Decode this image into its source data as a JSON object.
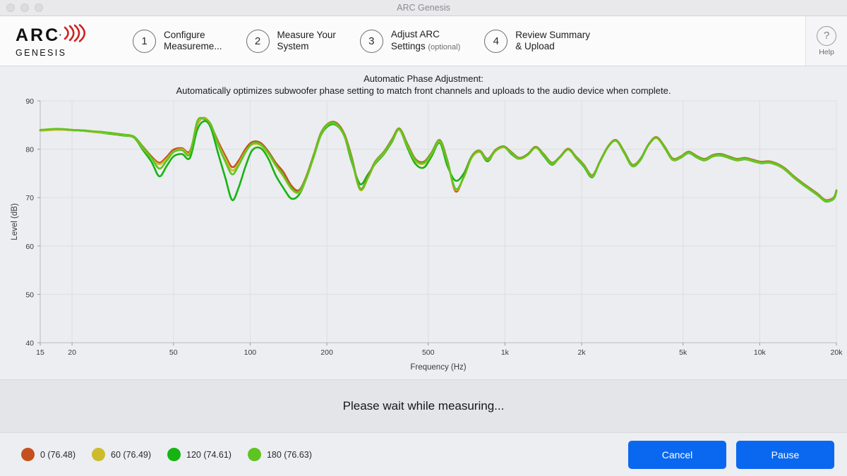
{
  "window": {
    "title": "ARC Genesis",
    "traffic_lights": [
      "close",
      "minimize",
      "zoom"
    ]
  },
  "header": {
    "logo": {
      "brand": "ARC",
      "sub": "GENESIS",
      "wave_color": "#cc2222"
    },
    "steps": [
      {
        "number": "1",
        "line1": "Configure",
        "line2": "Measureme...",
        "optional": ""
      },
      {
        "number": "2",
        "line1": "Measure Your",
        "line2": "System",
        "optional": ""
      },
      {
        "number": "3",
        "line1": "Adjust ARC",
        "line2": "Settings",
        "optional": "(optional)"
      },
      {
        "number": "4",
        "line1": "Review Summary",
        "line2": "& Upload",
        "optional": ""
      }
    ],
    "help": {
      "glyph": "?",
      "label": "Help"
    }
  },
  "main": {
    "caption_line1": "Automatic Phase Adjustment:",
    "caption_line2": "Automatically optimizes subwoofer phase setting to match front channels and uploads to the audio device when complete."
  },
  "status": {
    "text": "Please wait while measuring..."
  },
  "footer": {
    "legend": [
      {
        "label": "0 (76.48)",
        "color": "#c4501f"
      },
      {
        "label": "60 (76.49)",
        "color": "#ccbc2c"
      },
      {
        "label": "120 (74.61)",
        "color": "#15b411"
      },
      {
        "label": "180 (76.63)",
        "color": "#5ec420"
      }
    ],
    "buttons": [
      {
        "label": "Cancel",
        "color": "#0a68f0"
      },
      {
        "label": "Pause",
        "color": "#0a68f0"
      }
    ]
  },
  "chart_data": {
    "type": "line",
    "title": "",
    "xlabel": "Frequency (Hz)",
    "ylabel": "Level (dB)",
    "xscale": "log",
    "xlim": [
      15,
      20000
    ],
    "ylim": [
      40,
      90
    ],
    "grid": true,
    "legend_position": "bottom-left-outside",
    "xticks": [
      15,
      20,
      50,
      100,
      200,
      500,
      1000,
      2000,
      5000,
      10000,
      20000
    ],
    "xticklabels": [
      "15",
      "20",
      "50",
      "100",
      "200",
      "500",
      "1k",
      "2k",
      "5k",
      "10k",
      "20k"
    ],
    "yticks": [
      40,
      50,
      60,
      70,
      80,
      90
    ],
    "yticklabels": [
      "40",
      "50",
      "60",
      "70",
      "80",
      "90"
    ],
    "x": [
      15,
      16,
      17,
      18,
      19,
      20,
      22,
      24,
      26,
      28,
      30,
      32,
      35,
      38,
      41,
      44,
      47,
      50,
      54,
      58,
      62,
      66,
      70,
      75,
      80,
      85,
      90,
      96,
      102,
      110,
      118,
      126,
      135,
      145,
      155,
      165,
      178,
      190,
      205,
      220,
      235,
      250,
      270,
      290,
      310,
      335,
      360,
      385,
      415,
      445,
      480,
      515,
      555,
      595,
      640,
      690,
      740,
      795,
      855,
      920,
      990,
      1060,
      1140,
      1230,
      1320,
      1420,
      1530,
      1640,
      1770,
      1900,
      2040,
      2200,
      2360,
      2540,
      2730,
      2940,
      3160,
      3400,
      3660,
      3930,
      4230,
      4550,
      4890,
      5260,
      5660,
      6080,
      6540,
      7040,
      7570,
      8140,
      8760,
      9420,
      10130,
      10900,
      11720,
      12600,
      13560,
      14580,
      15680,
      16870,
      18140,
      19500,
      20000
    ],
    "series": [
      {
        "name": "0",
        "phase_deg": 0,
        "avg_level": 76.48,
        "color": "#c4501f",
        "values": [
          83.9,
          84.0,
          84.1,
          84.1,
          84.1,
          84.0,
          83.9,
          83.7,
          83.5,
          83.4,
          83.2,
          83.0,
          82.6,
          80.5,
          78.5,
          77.2,
          78.4,
          79.9,
          80.2,
          79.6,
          85.1,
          86.5,
          85.0,
          81.5,
          78.6,
          76.3,
          77.6,
          80.1,
          81.5,
          81.3,
          79.5,
          77.2,
          75.3,
          72.5,
          71.5,
          74.0,
          79.0,
          83.5,
          85.5,
          85.3,
          83.0,
          78.5,
          71.9,
          74.4,
          77.5,
          79.5,
          82.0,
          84.3,
          81.0,
          78.0,
          77.4,
          79.3,
          81.9,
          77.6,
          71.3,
          74.4,
          78.5,
          79.7,
          78.0,
          79.9,
          80.6,
          79.4,
          78.2,
          79.0,
          80.5,
          79.0,
          77.2,
          78.4,
          80.1,
          78.5,
          76.8,
          74.6,
          77.5,
          80.6,
          81.9,
          79.5,
          76.8,
          78.0,
          81.0,
          82.5,
          80.6,
          78.1,
          78.5,
          79.5,
          78.6,
          78.0,
          78.8,
          79.0,
          78.5,
          78.0,
          78.2,
          77.8,
          77.4,
          77.5,
          77.0,
          76.0,
          74.5,
          73.2,
          72.0,
          70.8,
          69.5,
          70.0,
          71.5,
          74.5,
          76.8
        ]
      },
      {
        "name": "60",
        "phase_deg": 60,
        "avg_level": 76.49,
        "color": "#ccbc2c",
        "values": [
          83.8,
          83.9,
          84.0,
          84.0,
          84.0,
          83.9,
          83.8,
          83.6,
          83.4,
          83.3,
          83.1,
          82.9,
          82.5,
          80.2,
          78.2,
          76.9,
          78.0,
          79.5,
          80.0,
          79.3,
          85.3,
          86.4,
          85.1,
          81.0,
          78.0,
          75.6,
          77.0,
          79.6,
          81.0,
          80.8,
          79.0,
          76.6,
          74.4,
          71.8,
          71.0,
          73.6,
          78.6,
          83.2,
          85.3,
          85.0,
          82.6,
          78.0,
          71.6,
          74.0,
          77.2,
          79.2,
          81.7,
          84.0,
          80.6,
          77.6,
          77.0,
          79.0,
          81.6,
          77.3,
          71.6,
          74.2,
          78.2,
          79.4,
          77.8,
          79.6,
          80.4,
          79.2,
          78.0,
          78.8,
          80.3,
          78.8,
          77.0,
          78.2,
          79.9,
          78.3,
          76.6,
          74.4,
          77.3,
          80.4,
          81.7,
          79.3,
          76.6,
          77.8,
          80.8,
          82.3,
          80.4,
          77.9,
          78.3,
          79.3,
          78.4,
          77.8,
          78.6,
          78.8,
          78.3,
          77.8,
          78.0,
          77.6,
          77.2,
          77.3,
          76.8,
          75.8,
          74.3,
          73.0,
          71.8,
          70.6,
          69.3,
          69.8,
          71.3,
          74.3,
          76.6
        ]
      },
      {
        "name": "120",
        "phase_deg": 120,
        "avg_level": 74.61,
        "color": "#15b411",
        "values": [
          83.9,
          84.0,
          84.1,
          84.1,
          84.0,
          83.9,
          83.8,
          83.6,
          83.4,
          83.2,
          83.0,
          82.8,
          82.4,
          79.8,
          77.4,
          74.4,
          76.5,
          78.5,
          79.0,
          78.2,
          84.0,
          85.8,
          84.5,
          79.0,
          74.0,
          69.5,
          72.0,
          76.5,
          79.8,
          80.2,
          78.0,
          74.6,
          72.0,
          69.8,
          70.5,
          73.5,
          78.5,
          83.0,
          85.0,
          84.8,
          82.5,
          77.5,
          72.8,
          74.8,
          77.0,
          79.0,
          81.5,
          84.0,
          80.2,
          77.0,
          76.2,
          78.5,
          81.3,
          76.5,
          73.5,
          75.0,
          78.5,
          79.5,
          77.5,
          79.8,
          80.5,
          79.0,
          78.0,
          79.0,
          80.4,
          78.6,
          76.8,
          78.3,
          80.0,
          78.2,
          76.4,
          74.2,
          77.4,
          80.5,
          81.8,
          79.2,
          76.5,
          77.7,
          80.9,
          82.4,
          80.3,
          77.8,
          78.2,
          79.2,
          78.3,
          77.7,
          78.5,
          78.7,
          78.2,
          77.7,
          77.9,
          77.5,
          77.1,
          77.2,
          76.7,
          75.7,
          74.2,
          72.9,
          71.7,
          70.5,
          69.2,
          69.7,
          71.2,
          74.2,
          76.5
        ]
      },
      {
        "name": "180",
        "phase_deg": 180,
        "avg_level": 76.63,
        "color": "#5ec420",
        "values": [
          84.0,
          84.1,
          84.2,
          84.2,
          84.1,
          84.0,
          83.9,
          83.7,
          83.6,
          83.4,
          83.2,
          83.0,
          82.6,
          80.4,
          78.2,
          76.0,
          77.6,
          79.4,
          79.8,
          79.0,
          85.8,
          86.2,
          85.2,
          80.8,
          77.4,
          74.8,
          76.6,
          79.4,
          81.2,
          81.0,
          79.2,
          76.8,
          74.6,
          72.0,
          71.2,
          73.8,
          78.8,
          83.4,
          85.4,
          85.1,
          82.8,
          78.2,
          71.8,
          74.2,
          77.4,
          79.4,
          81.8,
          84.2,
          80.8,
          77.8,
          77.2,
          79.2,
          81.8,
          77.4,
          71.8,
          74.3,
          78.4,
          79.6,
          77.9,
          79.8,
          80.5,
          79.3,
          78.1,
          78.9,
          80.4,
          78.9,
          77.1,
          78.3,
          80.0,
          78.4,
          76.7,
          74.5,
          77.4,
          80.5,
          81.8,
          79.4,
          76.7,
          77.9,
          80.9,
          82.4,
          80.5,
          78.0,
          78.4,
          79.4,
          78.5,
          77.9,
          78.7,
          78.9,
          78.4,
          77.9,
          78.1,
          77.7,
          77.3,
          77.4,
          76.9,
          75.9,
          74.4,
          73.1,
          71.9,
          70.7,
          69.4,
          69.9,
          71.4,
          74.4,
          76.7
        ]
      }
    ]
  }
}
